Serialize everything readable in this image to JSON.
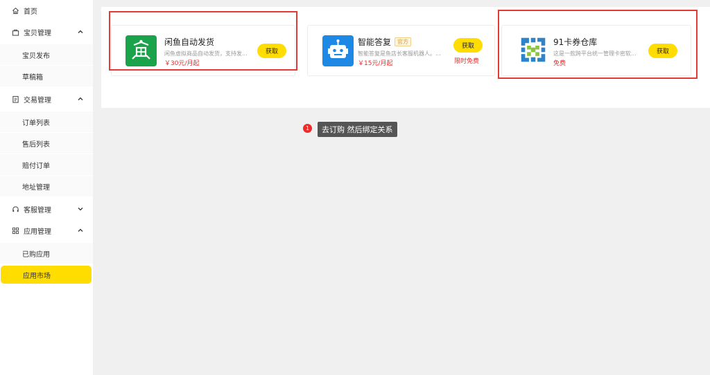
{
  "sidebar": {
    "home": "首页",
    "item_mgmt": "宝贝管理",
    "item_publish": "宝贝发布",
    "drafts": "草稿箱",
    "trade_mgmt": "交易管理",
    "order_list": "订单列表",
    "aftersale_list": "售后列表",
    "compensation_orders": "赔付订单",
    "address_mgmt": "地址管理",
    "service_mgmt": "客服管理",
    "app_mgmt": "应用管理",
    "purchased_apps": "已购应用",
    "app_market": "应用市场"
  },
  "apps": [
    {
      "name": "闲鱼自动发货",
      "desc": "闲鱼虚拟商品自动发货，支持发...",
      "price": "￥30元/月起",
      "button": "获取",
      "icon": "auto-delivery-icon",
      "color": "#1aa34a"
    },
    {
      "name": "智能答复",
      "tag": "官方",
      "desc": "智能答复是鱼店长客服机器人。...",
      "price": "￥15元/月起",
      "button": "获取",
      "extra": "限时免费",
      "icon": "robot-icon",
      "color": "#1e88e5"
    },
    {
      "name": "91卡券仓库",
      "desc": "这是一款跨平台统一管理卡密软...",
      "price": "免费",
      "button": "获取",
      "icon": "coupon-warehouse-icon"
    }
  ],
  "annotation": {
    "step": "1",
    "text": "去订购 然后绑定关系"
  },
  "colors": {
    "accent": "#ffdd00",
    "price_red": "#ec2a2a",
    "highlight_box": "#e53935"
  }
}
